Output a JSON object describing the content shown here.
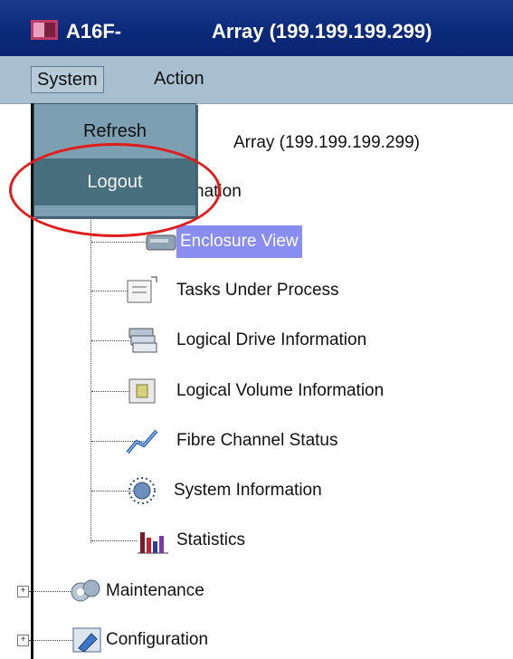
{
  "window": {
    "title_left": "A16F-",
    "title_right": "Array (199.199.199.299)"
  },
  "menubar": {
    "items": [
      {
        "label": "System"
      },
      {
        "label": "Action"
      }
    ]
  },
  "dropdown": {
    "items": [
      {
        "label": "Refresh"
      },
      {
        "label": "Logout"
      }
    ]
  },
  "tree": {
    "root_label": "Array (199.199.199.299)",
    "information_label_partial": "nation",
    "children": [
      {
        "label": "Enclosure View",
        "icon": "enclosure-icon",
        "selected": true
      },
      {
        "label": "Tasks Under Process",
        "icon": "tasks-icon"
      },
      {
        "label": "Logical Drive Information",
        "icon": "logical-drive-icon"
      },
      {
        "label": "Logical Volume Information",
        "icon": "logical-volume-icon"
      },
      {
        "label": "Fibre Channel Status",
        "icon": "fibre-channel-icon"
      },
      {
        "label": "System Information",
        "icon": "system-info-icon"
      },
      {
        "label": "Statistics",
        "icon": "statistics-icon"
      }
    ],
    "sections": [
      {
        "label": "Maintenance",
        "icon": "maintenance-icon"
      },
      {
        "label": "Configuration",
        "icon": "configuration-icon"
      }
    ]
  },
  "colors": {
    "title_bar": "#0b2a7a",
    "menu_bar": "#a8bfd0",
    "selected_highlight": "#8a8df0",
    "annotation": "#e21b1b"
  }
}
